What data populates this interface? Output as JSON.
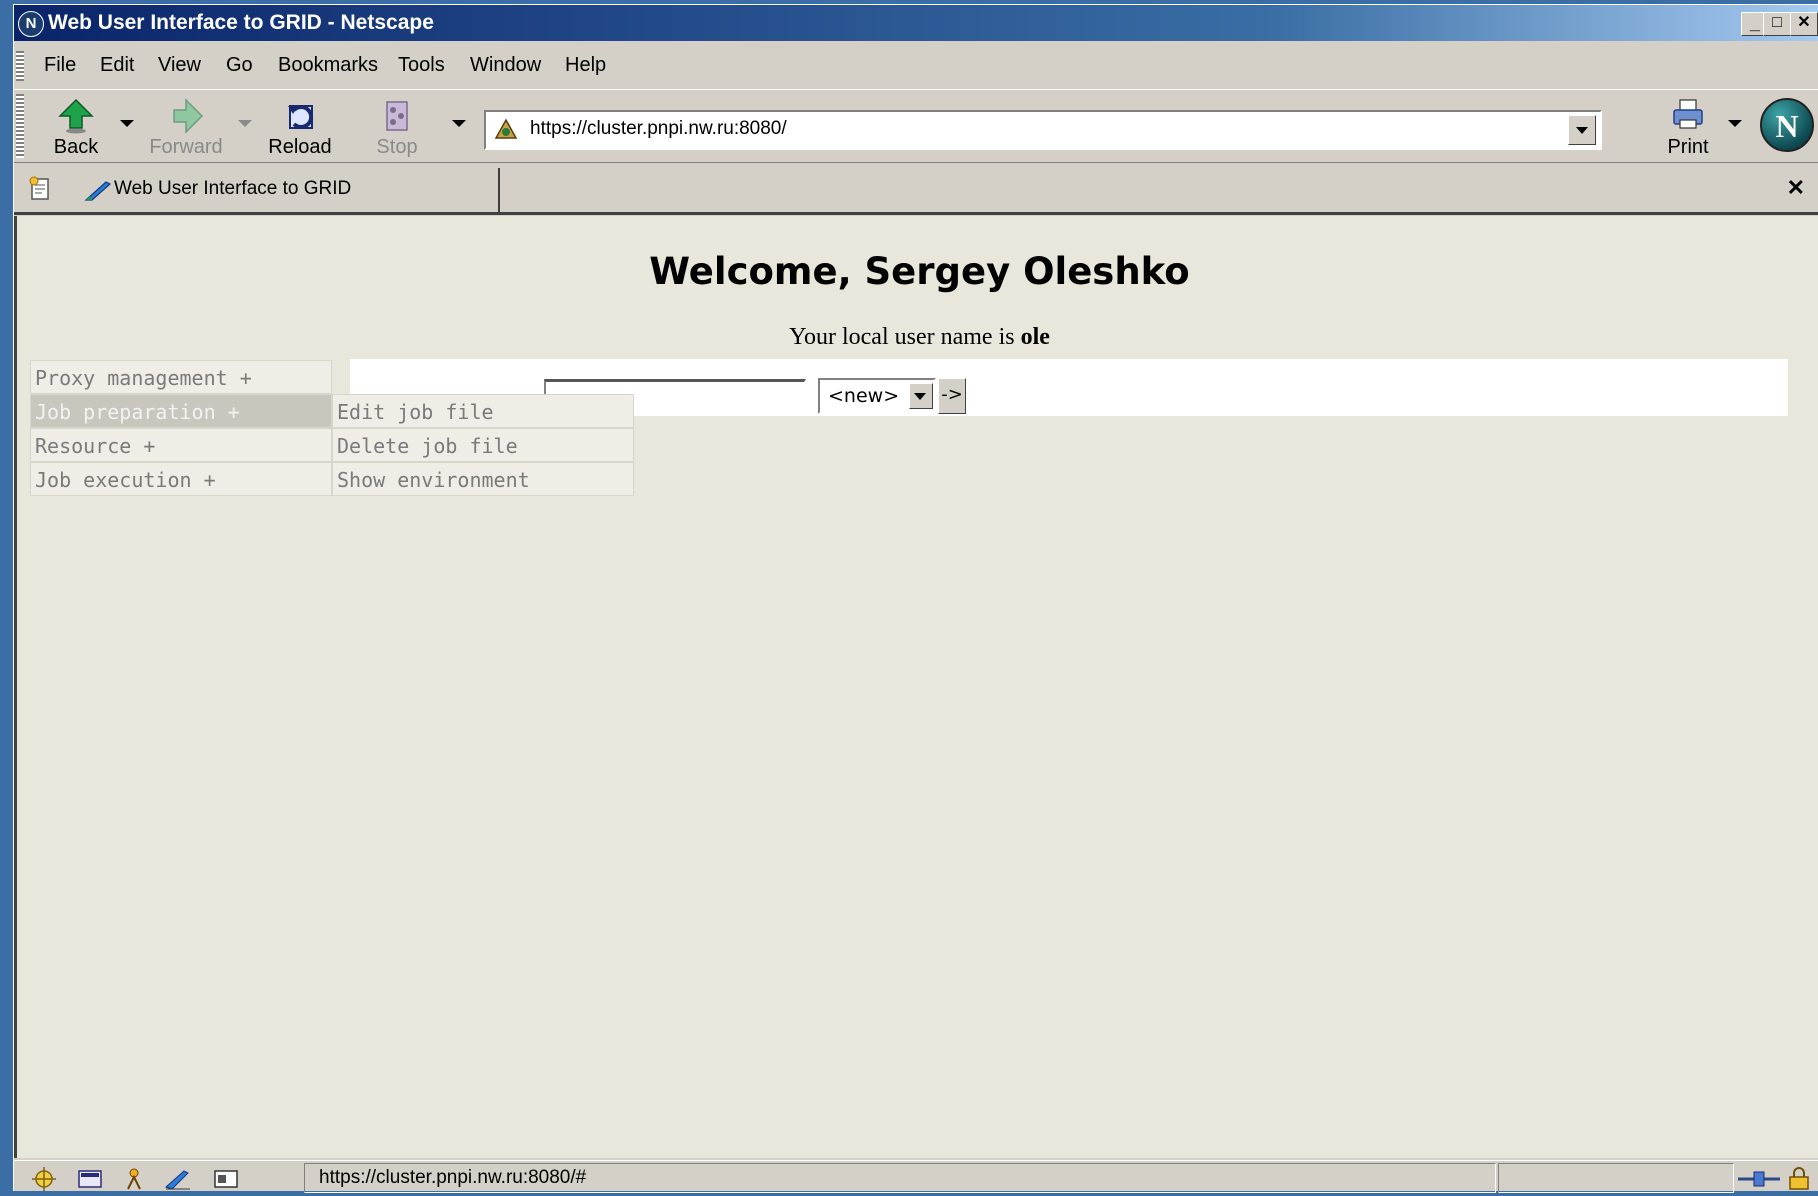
{
  "window": {
    "title": "Web User Interface to GRID - Netscape",
    "app_icon_glyph": "N",
    "minimize_glyph": "_",
    "maximize_glyph": "□",
    "close_glyph": "✕"
  },
  "menubar": {
    "items": [
      {
        "label": "File"
      },
      {
        "label": "Edit"
      },
      {
        "label": "View"
      },
      {
        "label": "Go"
      },
      {
        "label": "Bookmarks"
      },
      {
        "label": "Tools"
      },
      {
        "label": "Window"
      },
      {
        "label": "Help"
      }
    ]
  },
  "navbar": {
    "back": "Back",
    "forward": "Forward",
    "reload": "Reload",
    "stop": "Stop",
    "print": "Print",
    "url": "https://cluster.pnpi.nw.ru:8080/",
    "logo_glyph": "N"
  },
  "tabs": {
    "active_label": "Web User Interface to GRID",
    "close_glyph": "✕"
  },
  "page": {
    "welcome": "Welcome, Sergey Oleshko",
    "username_prefix": "Your local user name is",
    "username": "ole",
    "job_file_input_value": "",
    "job_select_value": "<new>",
    "go_button": "->",
    "main_menu": [
      {
        "label": "Proxy management +",
        "active": false
      },
      {
        "label": "Job preparation +",
        "active": true
      },
      {
        "label": "Resource +",
        "active": false
      },
      {
        "label": "Job execution +",
        "active": false
      }
    ],
    "submenu": [
      {
        "label": "Edit job file"
      },
      {
        "label": "Delete job file"
      },
      {
        "label": "Show environment"
      }
    ]
  },
  "statusbar": {
    "url": "https://cluster.pnpi.nw.ru:8080/#"
  },
  "colors": {
    "title_gradient_start": "#0a246a",
    "page_background": "#e9e6dc",
    "menu_active": "#c9c6be"
  },
  "icons": [
    "back-arrow-icon",
    "forward-arrow-icon",
    "reload-icon",
    "stop-icon",
    "print-icon",
    "lock-icon",
    "site-icon",
    "new-tab-icon",
    "tab-page-icon"
  ]
}
